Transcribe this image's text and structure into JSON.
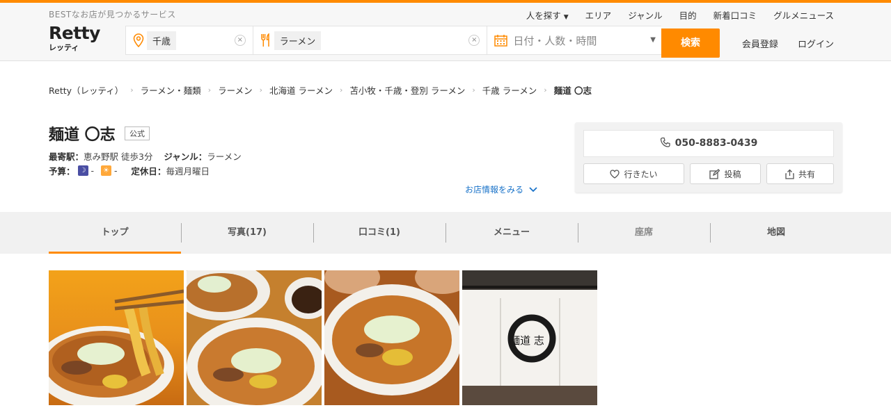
{
  "header": {
    "tagline": "BESTなお店が見つかるサービス",
    "logo_en": "Retty",
    "logo_jp": "レッティ",
    "nav": [
      {
        "label": "人を探す",
        "dropdown": true
      },
      {
        "label": "エリア"
      },
      {
        "label": "ジャンル"
      },
      {
        "label": "目的"
      },
      {
        "label": "新着口コミ"
      },
      {
        "label": "グルメニュース"
      }
    ],
    "search": {
      "area_value": "千歳",
      "genre_value": "ラーメン",
      "date_placeholder": "日付・人数・時間",
      "button": "検索"
    },
    "auth": {
      "register": "会員登録",
      "login": "ログイン"
    },
    "accent": "#ff8a00"
  },
  "breadcrumb": [
    "Retty（レッティ）",
    "ラーメン・麺類",
    "ラーメン",
    "北海道 ラーメン",
    "苫小牧・千歳・登別 ラーメン",
    "千歳 ラーメン",
    "麺道 〇志"
  ],
  "shop": {
    "name": "麺道 〇志",
    "official_badge": "公式",
    "station_label": "最寄駅：",
    "station_value": "恵み野駅 徒歩3分",
    "genre_label": "ジャンル：",
    "genre_value": "ラーメン",
    "budget_label": "予算：",
    "budget_night": "-",
    "budget_day": "-",
    "holiday_label": "定休日：",
    "holiday_value": "毎週月曜日",
    "info_link": "お店情報をみる"
  },
  "contact": {
    "phone": "050-8883-0439",
    "want": "行きたい",
    "post": "投稿",
    "share": "共有"
  },
  "tabs": [
    {
      "label": "トップ",
      "active": true
    },
    {
      "label": "写真(17)"
    },
    {
      "label": "口コミ(1)"
    },
    {
      "label": "メニュー"
    },
    {
      "label": "座席",
      "muted": true
    },
    {
      "label": "地図"
    }
  ],
  "noren_text": "麺道 志"
}
